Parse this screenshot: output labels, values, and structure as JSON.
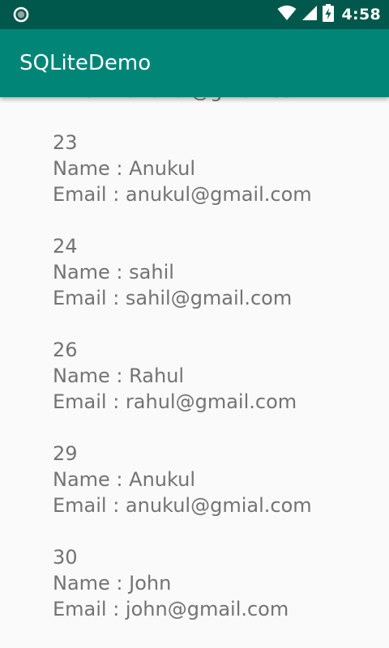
{
  "status_bar": {
    "time": "4:58",
    "icons": [
      "notification-ring-icon",
      "wifi-icon",
      "cell-signal-icon",
      "battery-charging-icon"
    ]
  },
  "app_bar": {
    "title": "SQLiteDemo"
  },
  "colors": {
    "status_bar": "#00574B",
    "app_bar": "#008577",
    "background": "#FAFAFA",
    "text": "#737373"
  },
  "records": [
    {
      "id": "",
      "name": "",
      "email": "Email : anukul@gmail.com"
    },
    {
      "id": "23",
      "name": "Name : Anukul",
      "email": "Email : anukul@gmail.com"
    },
    {
      "id": "24",
      "name": "Name : sahil",
      "email": "Email : sahil@gmail.com"
    },
    {
      "id": "26",
      "name": "Name : Rahul",
      "email": "Email : rahul@gmail.com"
    },
    {
      "id": "29",
      "name": "Name : Anukul",
      "email": "Email : anukul@gmial.com"
    },
    {
      "id": "30",
      "name": "Name : John",
      "email": "Email : john@gmail.com"
    }
  ]
}
